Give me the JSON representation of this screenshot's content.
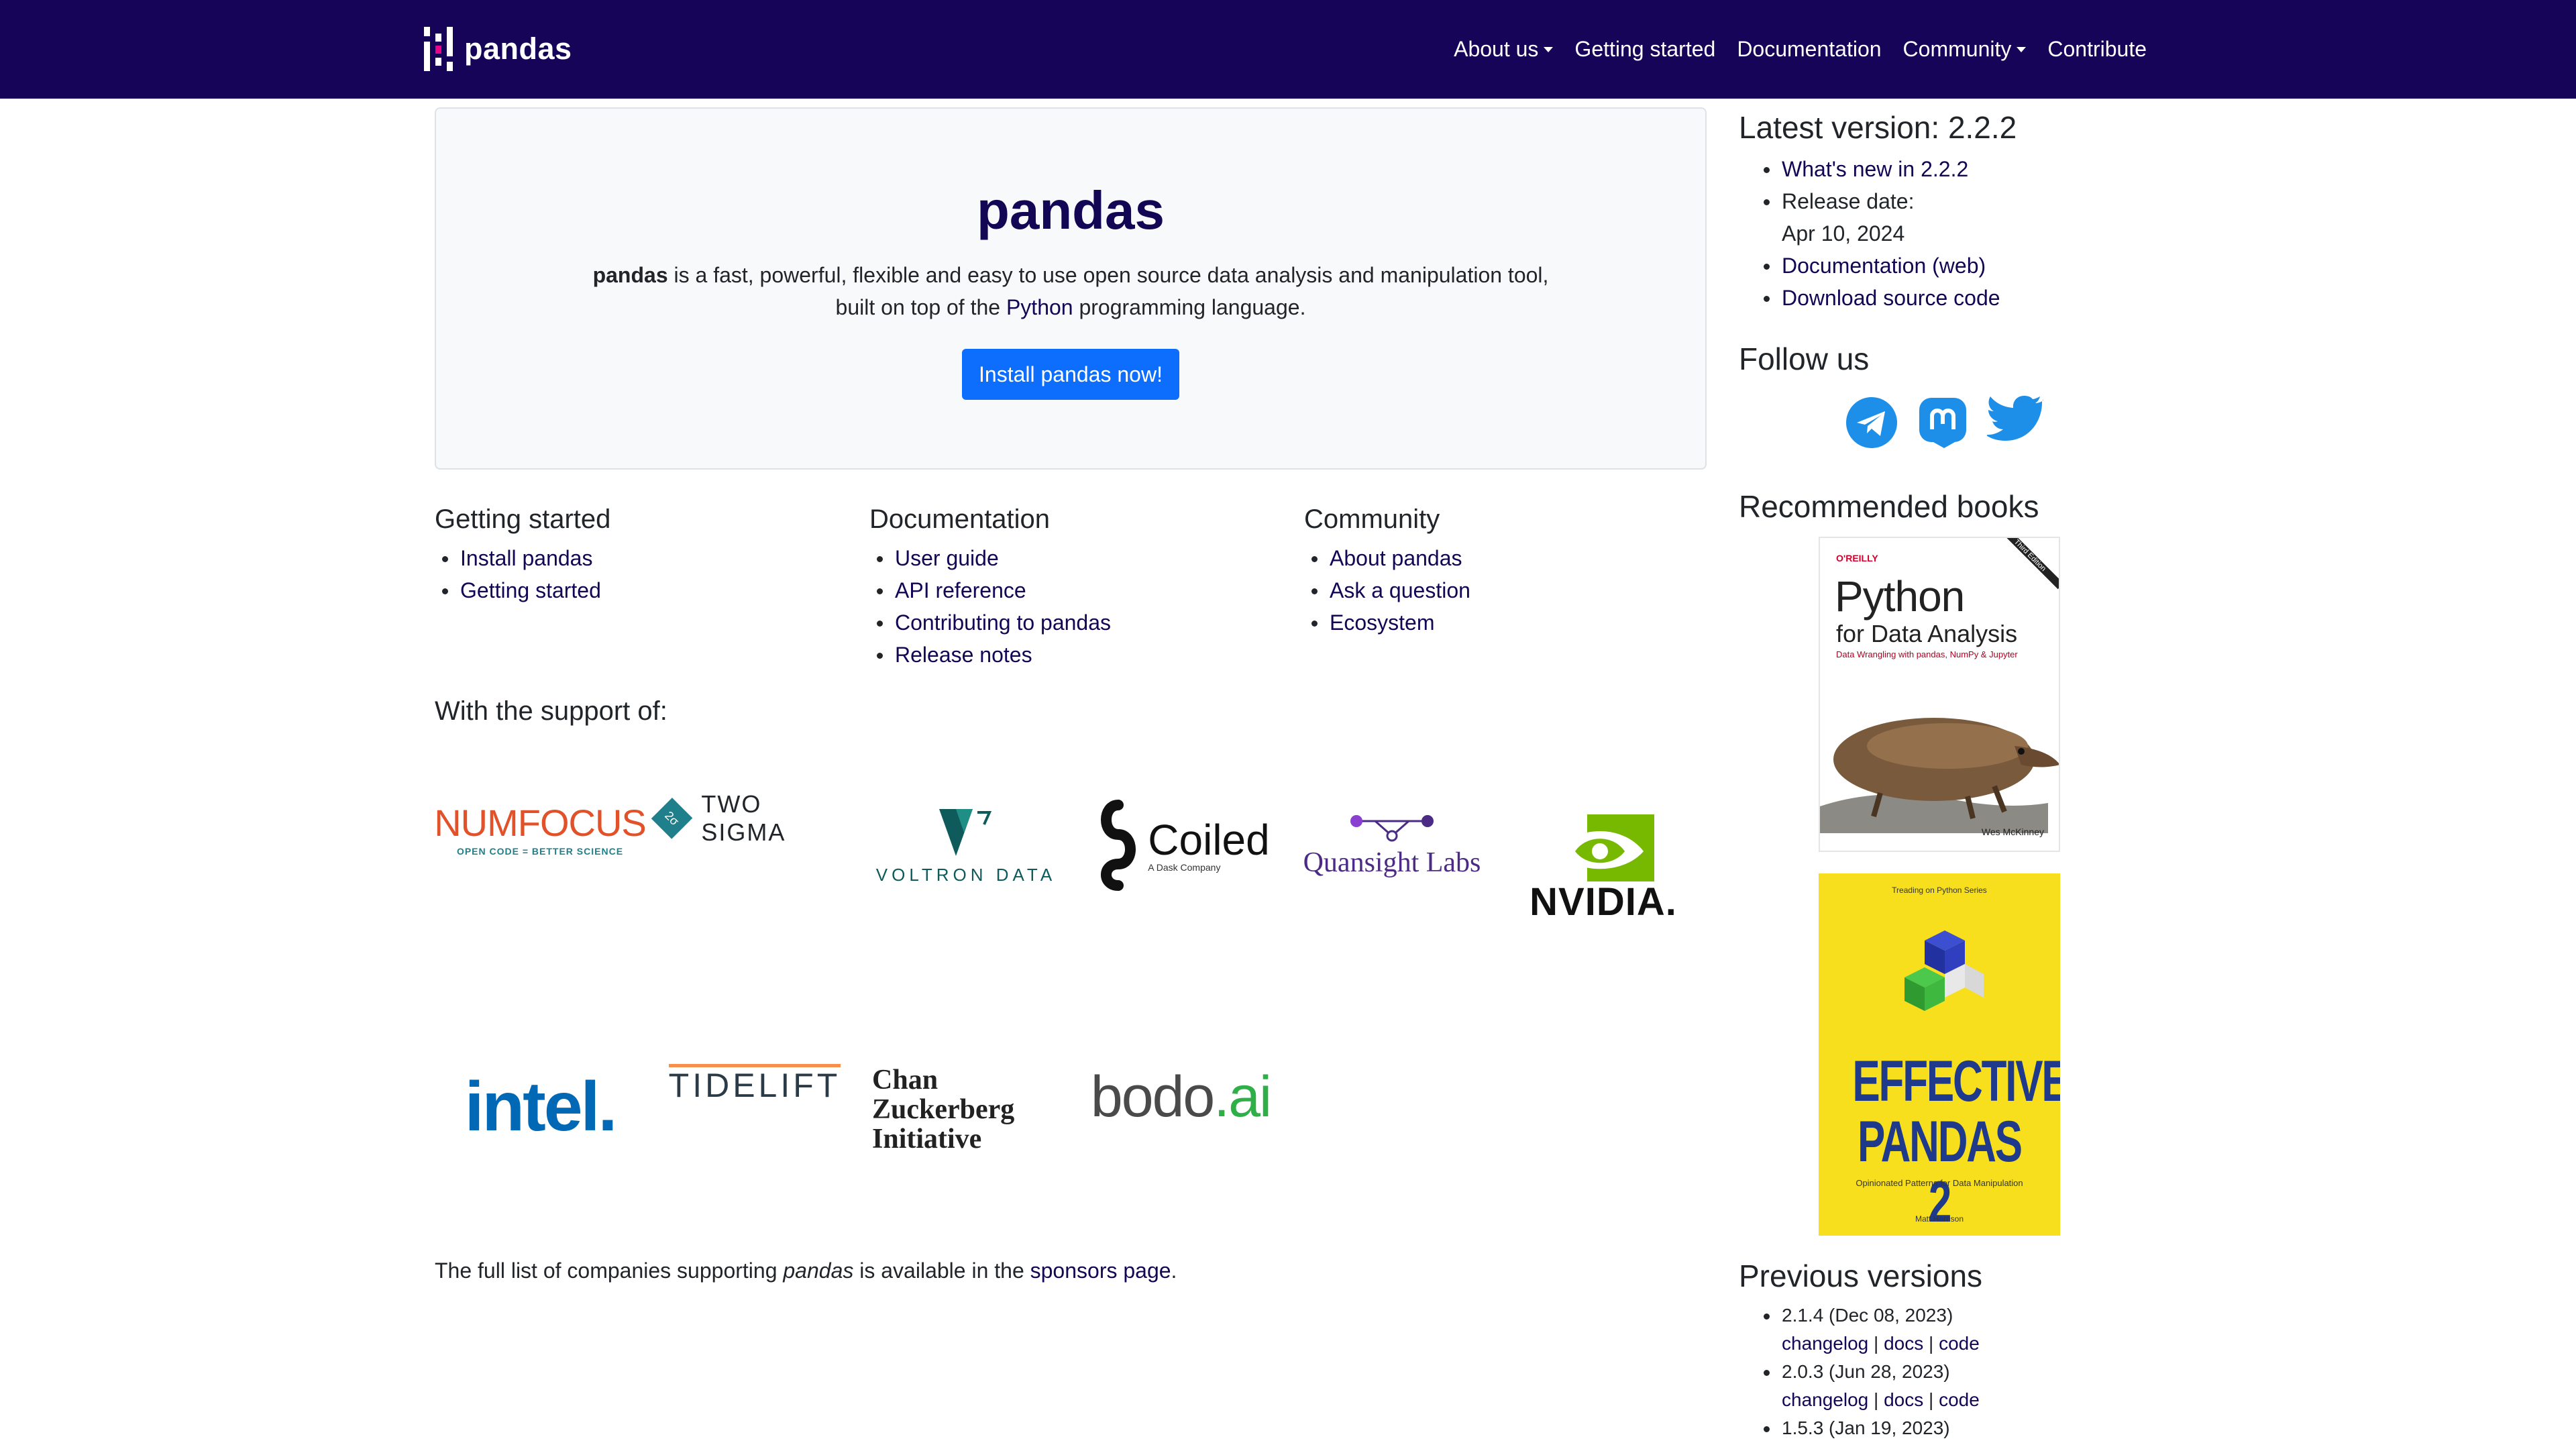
{
  "navbar": {
    "brand": "pandas",
    "items": [
      {
        "label": "About us",
        "dropdown": true
      },
      {
        "label": "Getting started",
        "dropdown": false
      },
      {
        "label": "Documentation",
        "dropdown": false
      },
      {
        "label": "Community",
        "dropdown": true
      },
      {
        "label": "Contribute",
        "dropdown": false
      }
    ]
  },
  "hero": {
    "title": "pandas",
    "text_bold": "pandas",
    "text_1": " is a fast, powerful, flexible and easy to use open source data analysis and manipulation tool,",
    "text_2": "built on top of the ",
    "text_link": "Python",
    "text_3": " programming language.",
    "button": "Install pandas now!"
  },
  "sections": [
    {
      "title": "Getting started",
      "links": [
        "Install pandas",
        "Getting started"
      ]
    },
    {
      "title": "Documentation",
      "links": [
        "User guide",
        "API reference",
        "Contributing to pandas",
        "Release notes"
      ]
    },
    {
      "title": "Community",
      "links": [
        "About pandas",
        "Ask a question",
        "Ecosystem"
      ]
    }
  ],
  "support": {
    "title": "With the support of:",
    "sponsors": {
      "numfocus": {
        "name": "NUMFOCUS",
        "tagline": "OPEN CODE = BETTER SCIENCE"
      },
      "twosigma": {
        "name": "TWO SIGMA",
        "badge": "2σ"
      },
      "voltron": {
        "name": "VOLTRON DATA"
      },
      "coiled": {
        "name": "Coiled",
        "tagline": "A Dask Company"
      },
      "quansight": {
        "name": "Quansight Labs"
      },
      "nvidia": {
        "name": "NVIDIA."
      },
      "intel": {
        "name": "intel."
      },
      "tidelift": {
        "name": "TIDELIFT"
      },
      "czi": {
        "line1": "Chan",
        "line2": "Zuckerberg",
        "line3": "Initiative"
      },
      "bodo": {
        "name1": "bodo",
        "name2": ".ai"
      }
    }
  },
  "footer": {
    "text_1": "The full list of companies supporting ",
    "text_em": "pandas",
    "text_2": " is available in the ",
    "link": "sponsors page",
    "text_3": "."
  },
  "sidebar": {
    "latest_title": "Latest version: 2.2.2",
    "latest_items": {
      "whats_new": "What's new in 2.2.2",
      "release_label": "Release date:",
      "release_date": "Apr 10, 2024",
      "docs": "Documentation (web)",
      "download": "Download source code"
    },
    "follow_title": "Follow us",
    "social_icons": [
      "telegram-icon",
      "mastodon-icon",
      "twitter-icon"
    ],
    "books_title": "Recommended books",
    "book1": {
      "publisher": "O'REILLY",
      "title1": "Python",
      "title2": "for Data Analysis",
      "subtitle": "Data Wrangling with pandas, NumPy & Jupyter",
      "corner": "Third Edition",
      "author": "Wes McKinney"
    },
    "book2": {
      "series": "Treading on Python Series",
      "title1": "EFFECTIVE",
      "title2": "PANDAS 2",
      "subtitle": "Opinionated Patterns for Data Manipulation",
      "author": "Matt Harrison"
    },
    "previous_title": "Previous versions",
    "previous": [
      {
        "version": "2.1.4 (Dec 08, 2023)",
        "links": [
          "changelog",
          "docs",
          "code"
        ]
      },
      {
        "version": "2.0.3 (Jun 28, 2023)",
        "links": [
          "changelog",
          "docs",
          "code"
        ]
      },
      {
        "version": "1.5.3 (Jan 19, 2023)"
      }
    ]
  },
  "colors": {
    "navbar": "#150458",
    "link": "#130654",
    "button": "#0d6efd",
    "social": "#1d8fe8",
    "book2": "#f7df1e"
  }
}
